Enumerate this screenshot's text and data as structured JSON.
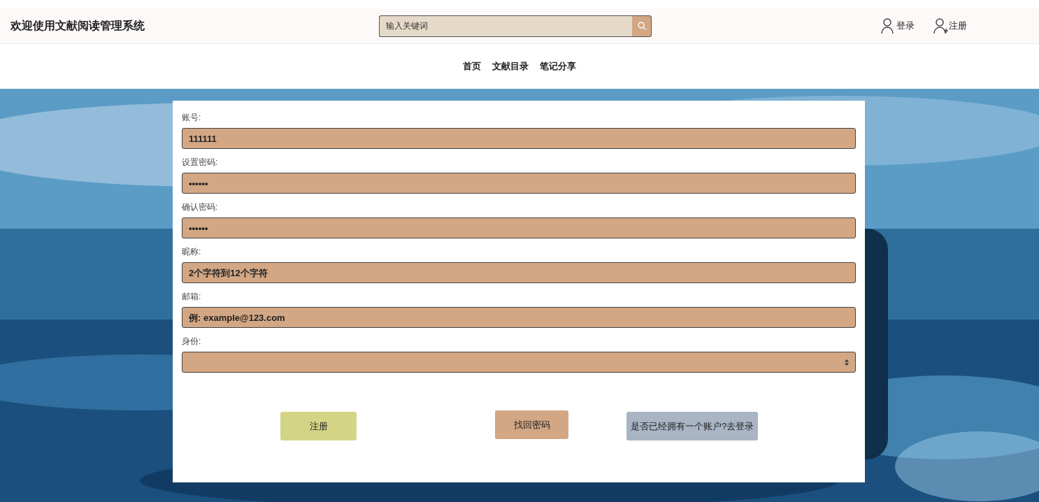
{
  "header": {
    "title": "欢迎使用文献阅读管理系统",
    "search": {
      "placeholder": "输入关键词"
    },
    "links": [
      {
        "label": "登录",
        "kind": "user"
      },
      {
        "label": "注册",
        "kind": "user-add"
      }
    ]
  },
  "nav": [
    {
      "label": "首页"
    },
    {
      "label": "文献目录"
    },
    {
      "label": "笔记分享"
    }
  ],
  "form": {
    "fields": [
      {
        "label": "账号:",
        "kind": "text",
        "value": "111111"
      },
      {
        "label": "设置密码:",
        "kind": "text",
        "value": "••••••"
      },
      {
        "label": "确认密码:",
        "kind": "text",
        "value": "••••••"
      },
      {
        "label": "昵称:",
        "kind": "text",
        "placeholder": "2个字符到12个字符"
      },
      {
        "label": "邮箱:",
        "kind": "text",
        "placeholder": "例: example@123.com"
      },
      {
        "label": "身份:",
        "kind": "select"
      }
    ],
    "buttons": [
      {
        "label": "注册",
        "color": "#d4d486"
      },
      {
        "label": "找回密码",
        "color": "#d3a784"
      },
      {
        "label": "是否已经拥有一个账户?去登录",
        "color": "#a9b4c5"
      }
    ]
  }
}
